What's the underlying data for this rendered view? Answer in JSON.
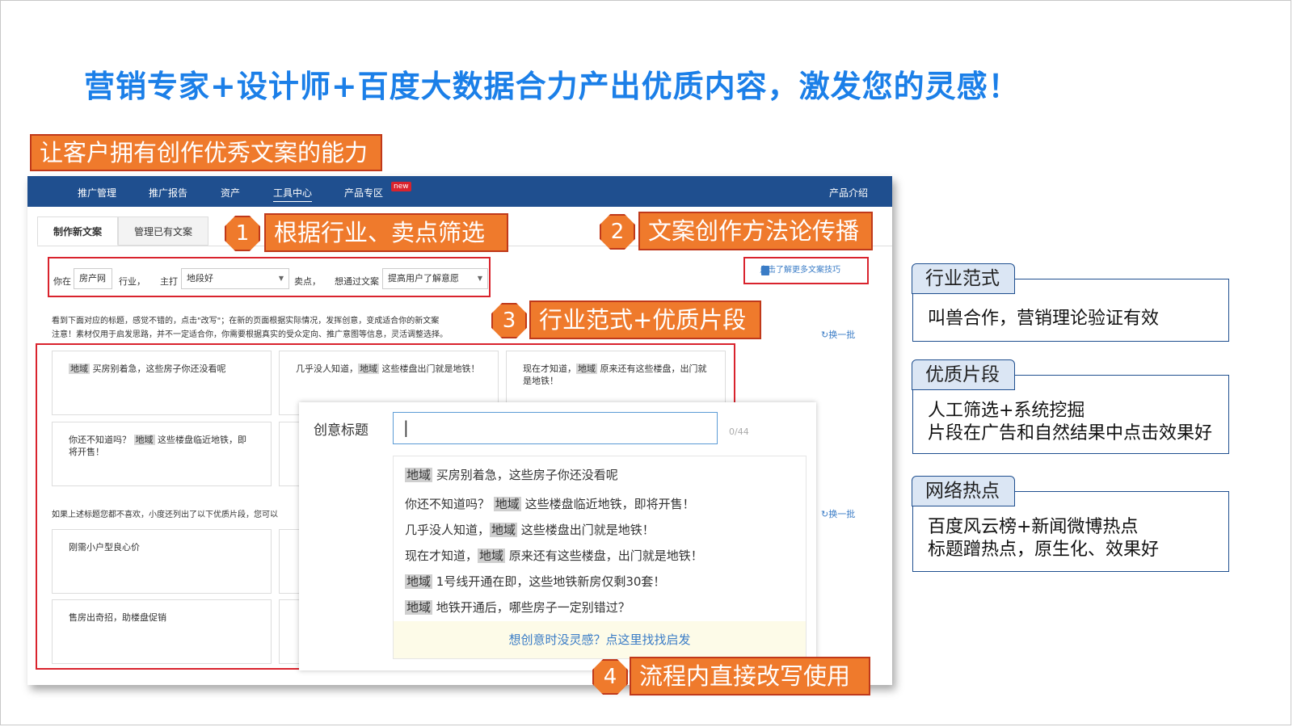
{
  "headline": "营销专家+设计师+百度大数据合力产出优质内容，激发您的灵感！",
  "ability_tag": "让客户拥有创作优秀文案的能力",
  "callouts": [
    {
      "num": "1",
      "text": "根据行业、卖点筛选"
    },
    {
      "num": "2",
      "text": "文案创作方法论传播"
    },
    {
      "num": "3",
      "text": "行业范式+优质片段"
    },
    {
      "num": "4",
      "text": "流程内直接改写使用"
    }
  ],
  "nav": {
    "items": [
      "推广管理",
      "推广报告",
      "资产",
      "工具中心",
      "产品专区"
    ],
    "new_badge": "new",
    "right": "产品介绍"
  },
  "tabs": [
    "制作新文案",
    "管理已有文案"
  ],
  "filter": {
    "prefix": "你在",
    "industry_value": "房产网",
    "industry_suffix": "行业，",
    "main_label": "主打",
    "main_value": "地段好",
    "selling_label": "卖点，",
    "goal_label": "想通过文案",
    "goal_value": "提高用户了解意愿"
  },
  "tips_link": "点击了解更多文案技巧",
  "hints": [
    "看到下面对应的标题，感觉不错的，点击\"改写\"；在新的页面根据实际情况，发挥创意，变成适合你的新文案",
    "注意！素材仅用于启发思路，并不一定适合你，你需要根据真实的受众定向、推广意图等信息，灵活调整选择。"
  ],
  "refresh": "换一批",
  "cards": [
    {
      "hl": "地域",
      "text": " 买房别着急，这些房子你还没看呢"
    },
    {
      "pre": "几乎没人知道，",
      "hl": "地域",
      "text": " 这些楼盘出门就是地铁！"
    },
    {
      "pre": "现在才知道，",
      "hl": "地域",
      "text": " 原来还有这些楼盘，出门就是地铁！"
    },
    {
      "pre": "你还不知道吗？ ",
      "hl": "地域",
      "text": " 这些楼盘临近地铁，即将开售！"
    }
  ],
  "more_hint": "如果上述标题您都不喜欢，小度还列出了以下优质片段，您可以",
  "snippets": [
    "刚需小户型良心价",
    "售房出奇招，助楼盘促销"
  ],
  "popup": {
    "label": "创意标题",
    "input_value": "|",
    "count": "0/44",
    "suggestions": [
      {
        "pre": "",
        "hl": "地域",
        "text": " 买房别着急，这些房子你还没看呢"
      },
      {
        "pre": "你还不知道吗？ ",
        "hl": "地域",
        "text": " 这些楼盘临近地铁，即将开售！"
      },
      {
        "pre": "几乎没人知道，",
        "hl": "地域",
        "text": " 这些楼盘出门就是地铁！"
      },
      {
        "pre": "现在才知道，",
        "hl": "地域",
        "text": " 原来还有这些楼盘，出门就是地铁！"
      },
      {
        "pre": "",
        "hl": "地域",
        "text": " 1号线开通在即，这些地铁新房仅剩30套！"
      },
      {
        "pre": "",
        "hl": "地域",
        "text": " 地铁开通后，哪些房子一定别错过？"
      }
    ],
    "footer": "想创意时没灵感？点这里找找启发"
  },
  "panels": [
    {
      "title": "行业范式",
      "lines": [
        "叫兽合作，营销理论验证有效"
      ]
    },
    {
      "title": "优质片段",
      "lines": [
        "人工筛选+系统挖掘",
        "片段在广告和自然结果中点击效果好"
      ]
    },
    {
      "title": "网络热点",
      "lines": [
        "百度风云榜+新闻微博热点",
        "标题蹭热点，原生化、效果好"
      ]
    }
  ]
}
